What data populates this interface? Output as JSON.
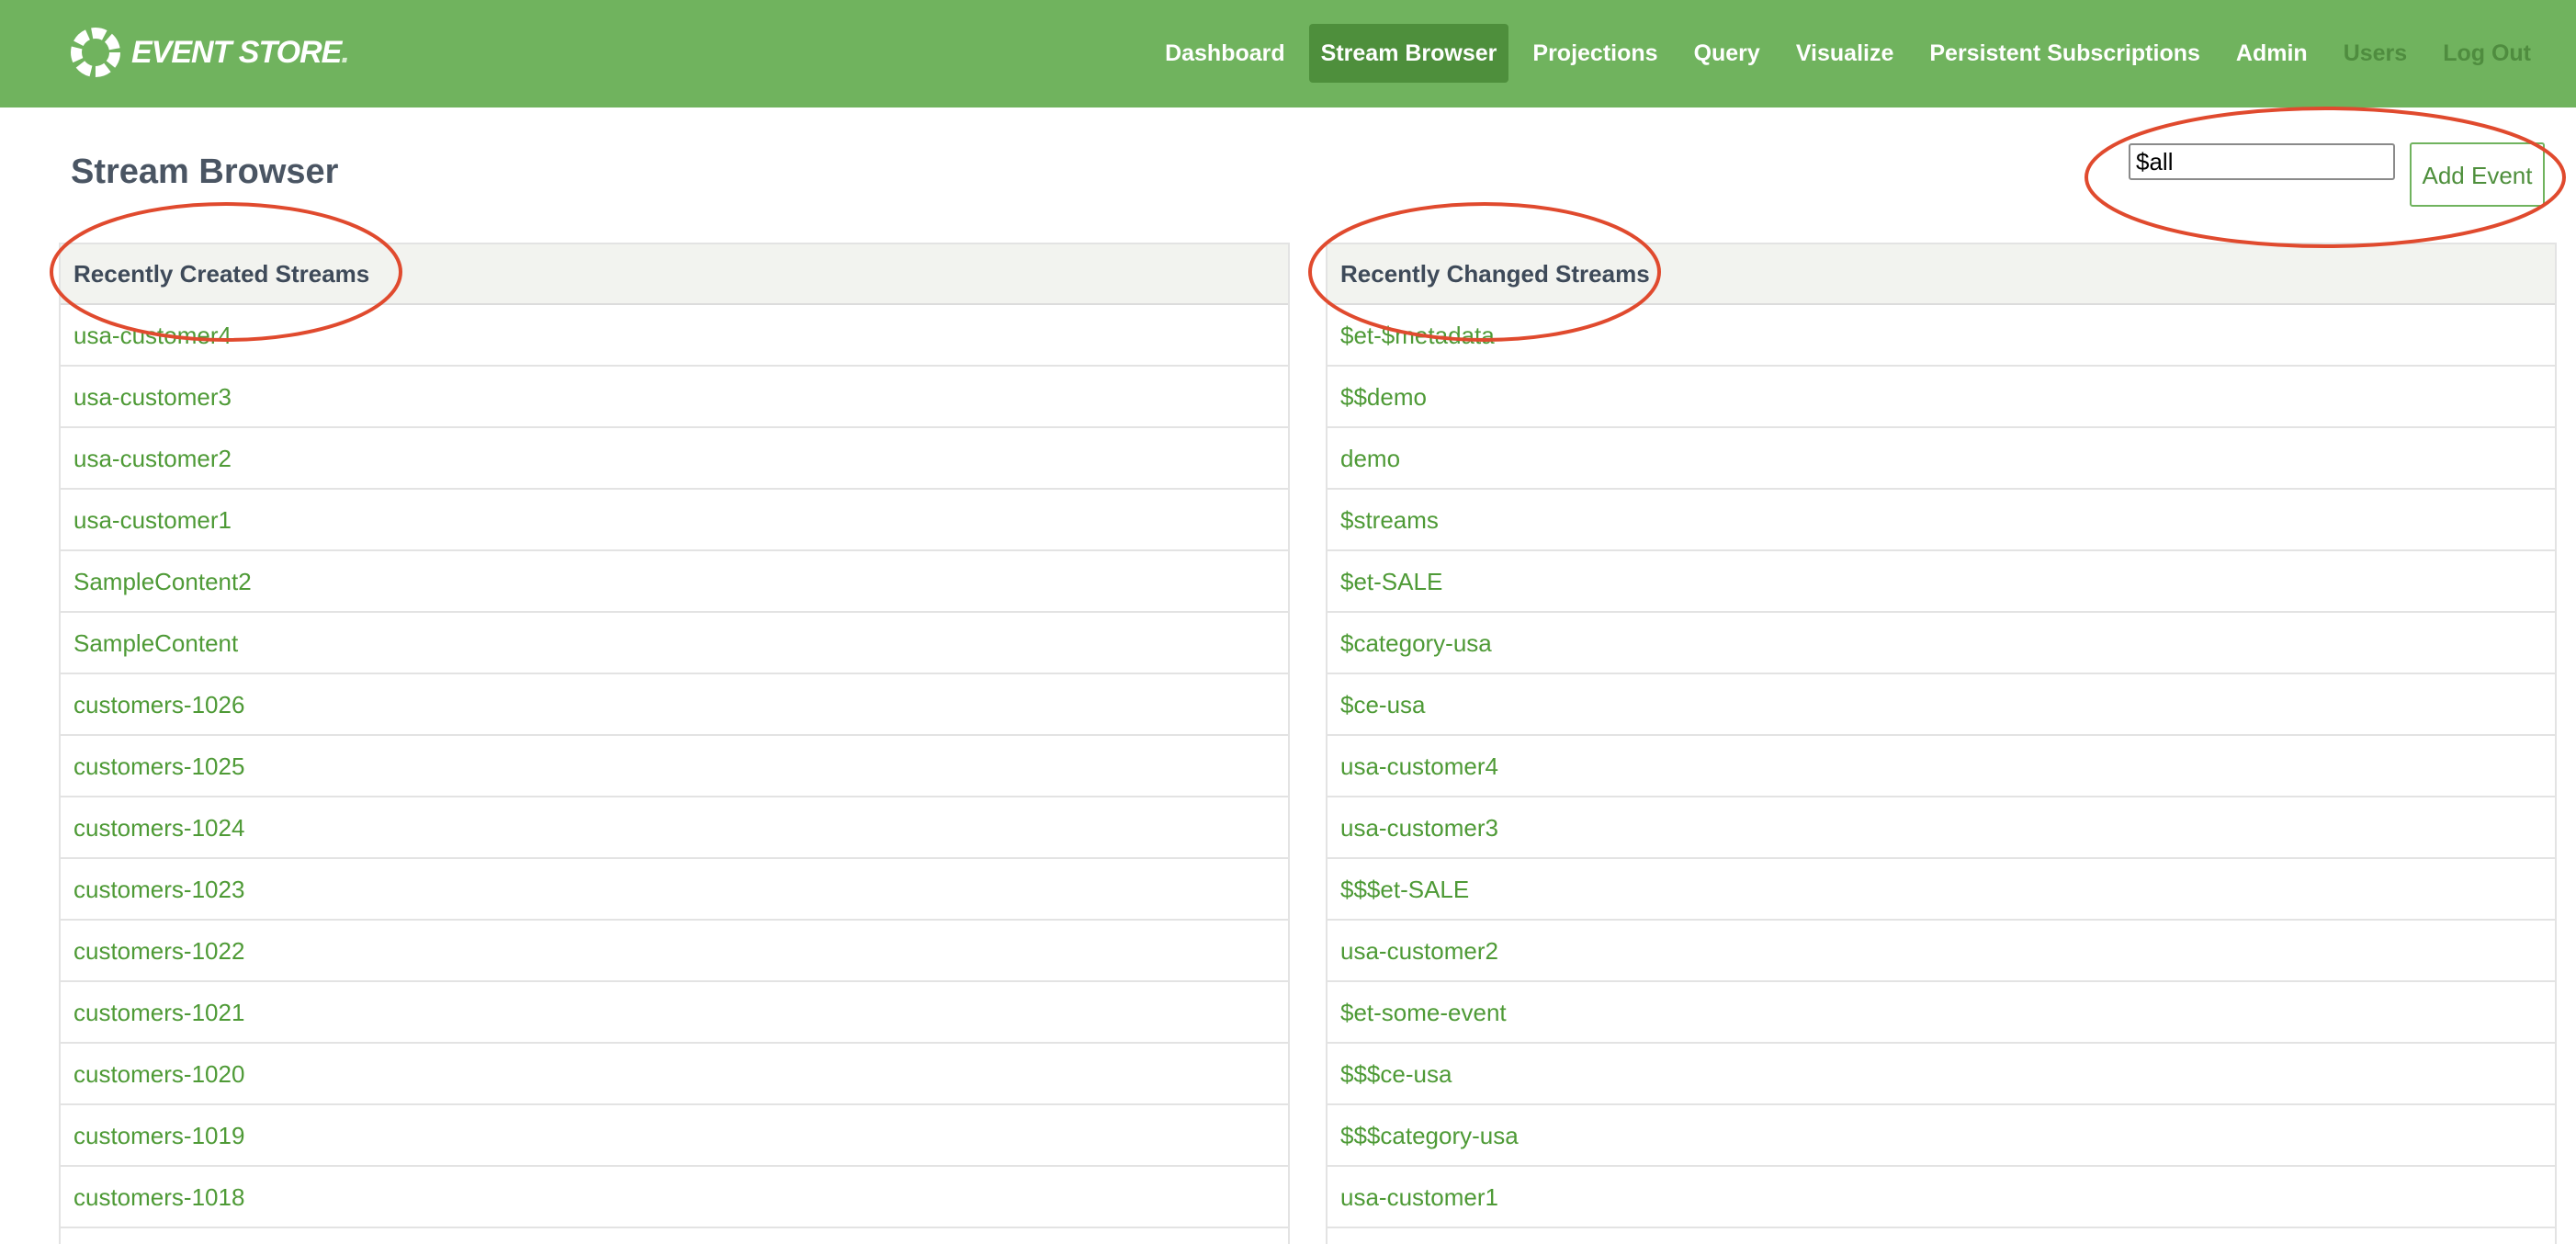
{
  "app": {
    "logo_text": "EVENT STORE",
    "logo_dot": "."
  },
  "nav": {
    "items": [
      {
        "label": "Dashboard"
      },
      {
        "label": "Stream Browser",
        "active": true
      },
      {
        "label": "Projections"
      },
      {
        "label": "Query"
      },
      {
        "label": "Visualize"
      },
      {
        "label": "Persistent Subscriptions"
      },
      {
        "label": "Admin"
      },
      {
        "label": "Users"
      },
      {
        "label": "Log Out"
      }
    ]
  },
  "page": {
    "title": "Stream Browser",
    "stream_input_value": "$all",
    "add_event_label": "Add Event"
  },
  "recently_created": {
    "title": "Recently Created Streams",
    "streams": [
      "usa-customer4",
      "usa-customer3",
      "usa-customer2",
      "usa-customer1",
      "SampleContent2",
      "SampleContent",
      "customers-1026",
      "customers-1025",
      "customers-1024",
      "customers-1023",
      "customers-1022",
      "customers-1021",
      "customers-1020",
      "customers-1019",
      "customers-1018"
    ]
  },
  "recently_changed": {
    "title": "Recently Changed Streams",
    "streams": [
      "$et-$metadata",
      "$$demo",
      "demo",
      "$streams",
      "$et-SALE",
      "$category-usa",
      "$ce-usa",
      "usa-customer4",
      "usa-customer3",
      "$$$et-SALE",
      "usa-customer2",
      "$et-some-event",
      "$$$ce-usa",
      "$$$category-usa",
      "usa-customer1"
    ]
  },
  "colors": {
    "topbar": "#70b35e",
    "active_nav": "#4e8f3c",
    "link": "#4e9a36",
    "annotation": "#e04a2e"
  }
}
